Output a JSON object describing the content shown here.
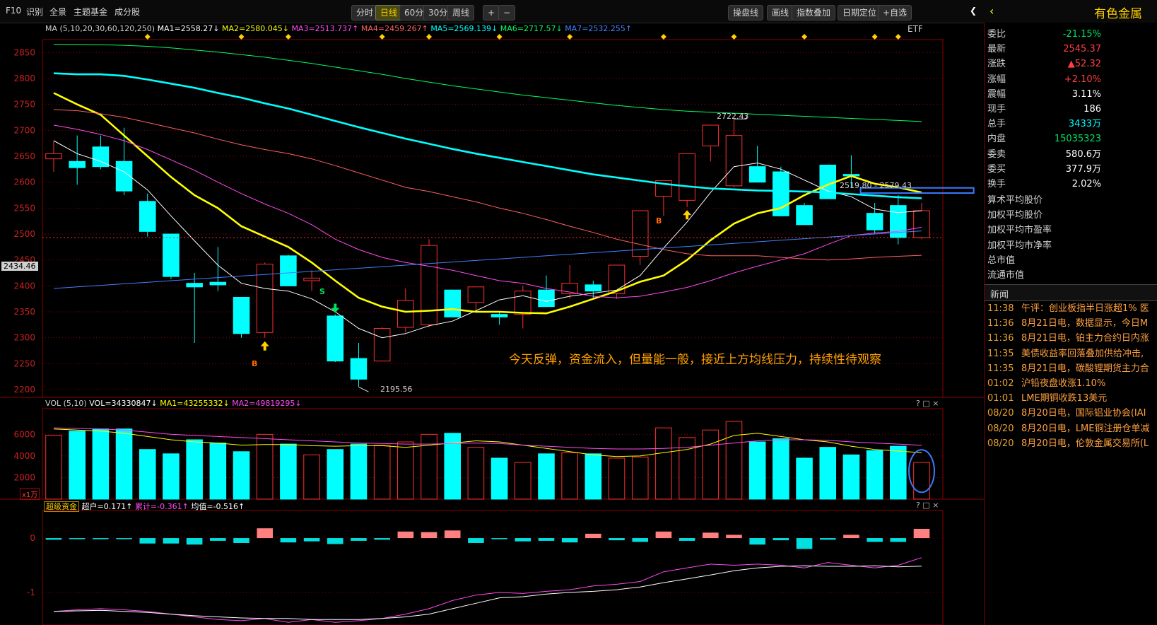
{
  "toolbar": {
    "left_items": [
      "F10",
      "识别",
      "全景",
      "主题基金",
      "成分股"
    ],
    "periods": [
      "分时",
      "日线",
      "60分",
      "30分",
      "周线"
    ],
    "active_period": "日线",
    "zoom_in": "+",
    "zoom_out": "−",
    "right_items": [
      "操盘线",
      "画线",
      "指数叠加",
      "日期定位",
      "+自选"
    ],
    "panel_title": "有色金属"
  },
  "ma_legend": {
    "prefix": "MA",
    "params": "(5,10,20,30,60,120,250)",
    "items": [
      {
        "label": "MA1=2558.27↓",
        "color": "#ffffff"
      },
      {
        "label": "MA2=2580.045↓",
        "color": "#ffff00"
      },
      {
        "label": "MA3=2513.737↑",
        "color": "#ff4af0"
      },
      {
        "label": "MA4=2459.267↑",
        "color": "#ff6060"
      },
      {
        "label": "MA5=2569.139↓",
        "color": "#00ffff"
      },
      {
        "label": "MA6=2717.57↓",
        "color": "#00ff60"
      },
      {
        "label": "MA7=2532.255↑",
        "color": "#4080ff"
      }
    ],
    "etf": "ETF"
  },
  "vol_legend": {
    "prefix": "VOL",
    "params": "(5,10)",
    "items": [
      {
        "label": "VOL=34330847↓",
        "color": "#ffffff"
      },
      {
        "label": "MA1=43255332↓",
        "color": "#ffff00"
      },
      {
        "label": "MA2=49819295↓",
        "color": "#ff4af0"
      }
    ],
    "unit": "x1万"
  },
  "fund_legend": {
    "name": "超级资金",
    "items": [
      {
        "label": "超户=0.171↑",
        "color": "#ffffff"
      },
      {
        "label": "累计=-0.361↑",
        "color": "#ff4af0"
      },
      {
        "label": "均值=-0.516↑",
        "color": "#ffffff"
      }
    ]
  },
  "panel_controls": "? □ ×",
  "annotations": {
    "comment": "今天反弹，资金流入，但量能一般，接近上方均线压力，持续性待观察",
    "high_label": "2722.43",
    "low_label": "2195.56",
    "range_label": "2519.80 - 2579.43",
    "cursor_price": "2434.46",
    "signal_b": "B",
    "signal_s": "S"
  },
  "quote": {
    "rows": [
      {
        "label": "委比",
        "value": "-21.15%",
        "color": "#00e060"
      },
      {
        "label": "最新",
        "value": "2545.37",
        "color": "#ff4040"
      },
      {
        "label": "涨跌",
        "value": "▲52.32",
        "color": "#ff4040"
      },
      {
        "label": "涨幅",
        "value": "+2.10%",
        "color": "#ff4040"
      },
      {
        "label": "震幅",
        "value": "3.11%",
        "color": "#ffffff"
      },
      {
        "label": "现手",
        "value": "186",
        "color": "#ffffff"
      },
      {
        "label": "总手",
        "value": "3433万",
        "color": "#00ffff"
      },
      {
        "label": "内盘",
        "value": "15035323",
        "color": "#00e060"
      },
      {
        "label": "委卖",
        "value": "580.6万",
        "color": "#ffffff"
      },
      {
        "label": "委买",
        "value": "377.9万",
        "color": "#ffffff"
      },
      {
        "label": "换手",
        "value": "2.02%",
        "color": "#ffffff"
      }
    ],
    "extra": [
      "算术平均股价",
      "加权平均股价",
      "加权平均市盈率",
      "加权平均市净率",
      "总市值",
      "流通市值"
    ]
  },
  "news": {
    "title": "新闻",
    "items": [
      {
        "time": "11:38",
        "text": "午评：创业板指半日涨超1% 医"
      },
      {
        "time": "11:36",
        "text": "8月21日电，数据显示，今日M"
      },
      {
        "time": "11:36",
        "text": "8月21日电，铂主力合约日内涨"
      },
      {
        "time": "11:35",
        "text": "美债收益率回落叠加供给冲击,"
      },
      {
        "time": "11:35",
        "text": "8月21日电，碳酸锂期货主力合"
      },
      {
        "time": "01:02",
        "text": "沪铅夜盘收涨1.10%"
      },
      {
        "time": "01:01",
        "text": "LME期铜收跌13美元"
      },
      {
        "time": "08/20",
        "text": "8月20日电，国际铝业协会(IAI"
      },
      {
        "time": "08/20",
        "text": "8月20日电，LME铜注册仓单减"
      },
      {
        "time": "08/20",
        "text": "8月20日电，伦敦金属交易所(L"
      }
    ]
  },
  "chart_data": [
    {
      "type": "candlestick",
      "ylim": [
        2185,
        2875
      ],
      "yticks": [
        2200,
        2250,
        2300,
        2350,
        2400,
        2450,
        2500,
        2550,
        2600,
        2650,
        2700,
        2750,
        2800,
        2850
      ],
      "ohlc": [
        [
          2645,
          2680,
          2620,
          2655
        ],
        [
          2640,
          2690,
          2595,
          2628
        ],
        [
          2668,
          2690,
          2625,
          2630
        ],
        [
          2640,
          2705,
          2575,
          2583
        ],
        [
          2563,
          2578,
          2495,
          2505
        ],
        [
          2500,
          2500,
          2413,
          2418
        ],
        [
          2405,
          2425,
          2290,
          2398
        ],
        [
          2407,
          2475,
          2390,
          2402
        ],
        [
          2378,
          2378,
          2300,
          2308
        ],
        [
          2310,
          2445,
          2300,
          2442
        ],
        [
          2458,
          2460,
          2400,
          2400
        ],
        [
          2410,
          2430,
          2390,
          2415
        ],
        [
          2342,
          2345,
          2253,
          2255
        ],
        [
          2260,
          2290,
          2205,
          2220
        ],
        [
          2255,
          2320,
          2255,
          2318
        ],
        [
          2320,
          2395,
          2310,
          2372
        ],
        [
          2325,
          2490,
          2320,
          2478
        ],
        [
          2392,
          2393,
          2340,
          2340
        ],
        [
          2368,
          2398,
          2350,
          2398
        ],
        [
          2345,
          2350,
          2325,
          2340
        ],
        [
          2345,
          2400,
          2318,
          2390
        ],
        [
          2392,
          2420,
          2360,
          2360
        ],
        [
          2385,
          2440,
          2375,
          2405
        ],
        [
          2402,
          2410,
          2375,
          2390
        ],
        [
          2385,
          2440,
          2375,
          2440
        ],
        [
          2457,
          2545,
          2440,
          2545
        ],
        [
          2573,
          2603,
          2535,
          2603
        ],
        [
          2565,
          2650,
          2552,
          2655
        ],
        [
          2670,
          2710,
          2640,
          2710
        ],
        [
          2593,
          2722,
          2590,
          2690
        ],
        [
          2630,
          2670,
          2600,
          2600
        ],
        [
          2620,
          2630,
          2535,
          2535
        ],
        [
          2555,
          2560,
          2518,
          2518
        ],
        [
          2633,
          2633,
          2568,
          2568
        ],
        [
          2615,
          2652,
          2590,
          2612
        ],
        [
          2540,
          2560,
          2500,
          2508
        ],
        [
          2555,
          2575,
          2480,
          2493
        ],
        [
          2493,
          2560,
          2490,
          2545
        ]
      ],
      "ma": [
        {
          "name": "MA1",
          "color": "#ffffff",
          "values": [
            2680,
            2655,
            2640,
            2620,
            2585,
            2535,
            2487,
            2440,
            2405,
            2395,
            2390,
            2375,
            2350,
            2318,
            2300,
            2308,
            2323,
            2332,
            2352,
            2373,
            2381,
            2370,
            2380,
            2386,
            2392,
            2420,
            2473,
            2523,
            2580,
            2630,
            2637,
            2625,
            2604,
            2583,
            2572,
            2548,
            2541,
            2545
          ]
        },
        {
          "name": "MA2",
          "color": "#ffff00",
          "values": [
            2772,
            2750,
            2730,
            2690,
            2650,
            2610,
            2575,
            2550,
            2515,
            2495,
            2475,
            2445,
            2410,
            2377,
            2360,
            2350,
            2352,
            2355,
            2350,
            2350,
            2348,
            2347,
            2360,
            2375,
            2390,
            2408,
            2420,
            2450,
            2488,
            2520,
            2540,
            2550,
            2575,
            2595,
            2612,
            2597,
            2590,
            2580
          ]
        },
        {
          "name": "MA3",
          "color": "#ff4af0",
          "values": [
            2710,
            2702,
            2692,
            2680,
            2663,
            2643,
            2623,
            2600,
            2578,
            2558,
            2540,
            2518,
            2490,
            2470,
            2455,
            2445,
            2438,
            2430,
            2420,
            2410,
            2405,
            2395,
            2388,
            2380,
            2377,
            2380,
            2388,
            2397,
            2410,
            2425,
            2438,
            2450,
            2462,
            2480,
            2497,
            2502,
            2505,
            2513
          ]
        },
        {
          "name": "MA4",
          "color": "#ff6060",
          "values": [
            2740,
            2738,
            2732,
            2725,
            2715,
            2705,
            2695,
            2683,
            2672,
            2663,
            2655,
            2645,
            2632,
            2618,
            2604,
            2590,
            2582,
            2572,
            2562,
            2550,
            2540,
            2528,
            2515,
            2503,
            2490,
            2480,
            2470,
            2462,
            2458,
            2458,
            2458,
            2455,
            2452,
            2450,
            2452,
            2455,
            2457,
            2459
          ]
        },
        {
          "name": "MA5",
          "color": "#00ffff",
          "values": [
            2810,
            2808,
            2808,
            2805,
            2798,
            2790,
            2782,
            2772,
            2763,
            2752,
            2742,
            2730,
            2718,
            2706,
            2695,
            2684,
            2674,
            2664,
            2655,
            2647,
            2639,
            2631,
            2623,
            2615,
            2609,
            2603,
            2597,
            2592,
            2588,
            2586,
            2584,
            2583,
            2582,
            2580,
            2577,
            2574,
            2571,
            2569
          ]
        },
        {
          "name": "MA6",
          "color": "#00ff60",
          "values": [
            2866,
            2866,
            2865,
            2864,
            2862,
            2859,
            2855,
            2851,
            2846,
            2841,
            2835,
            2829,
            2822,
            2815,
            2808,
            2800,
            2793,
            2786,
            2780,
            2774,
            2768,
            2763,
            2758,
            2753,
            2748,
            2744,
            2740,
            2737,
            2735,
            2733,
            2731,
            2729,
            2727,
            2725,
            2723,
            2721,
            2719,
            2717
          ]
        },
        {
          "name": "MA7",
          "color": "#4080ff",
          "values": [
            2395,
            2398,
            2401,
            2404,
            2407,
            2410,
            2413,
            2416,
            2419,
            2422,
            2425,
            2428,
            2431,
            2434,
            2437,
            2440,
            2443,
            2446,
            2449,
            2452,
            2455,
            2458,
            2461,
            2464,
            2467,
            2470,
            2473,
            2476,
            2479,
            2482,
            2485,
            2488,
            2491,
            2494,
            2497,
            2500,
            2503,
            2506
          ]
        }
      ]
    },
    {
      "type": "bar",
      "ylim": [
        0,
        7200
      ],
      "yticks": [
        2000,
        4000,
        6000
      ],
      "values": [
        5900,
        6300,
        6500,
        6500,
        4600,
        4200,
        5500,
        5200,
        4400,
        6000,
        5100,
        4100,
        4600,
        5100,
        5000,
        5300,
        6000,
        6100,
        4800,
        3800,
        3400,
        4200,
        4300,
        4200,
        3800,
        3900,
        6600,
        5700,
        6400,
        7200,
        5300,
        5600,
        3800,
        4800,
        4100,
        4500,
        4900,
        3400
      ],
      "ma": [
        {
          "name": "MA1",
          "color": "#ffff00",
          "values": [
            6500,
            6400,
            6300,
            6100,
            5800,
            5500,
            5300,
            5200,
            5000,
            5050,
            5050,
            4950,
            4900,
            4950,
            4950,
            4800,
            5000,
            5200,
            5400,
            5300,
            5000,
            4700,
            4400,
            4100,
            3950,
            4000,
            4300,
            4600,
            5100,
            5900,
            6100,
            5800,
            5500,
            5300,
            4900,
            4600,
            4450,
            4300
          ]
        },
        {
          "name": "MA2",
          "color": "#ff4af0",
          "values": [
            6600,
            6550,
            6500,
            6400,
            6200,
            6000,
            5900,
            5800,
            5700,
            5600,
            5500,
            5400,
            5300,
            5200,
            5150,
            5100,
            5100,
            5150,
            5200,
            5150,
            5000,
            4900,
            4800,
            4700,
            4650,
            4650,
            4700,
            4800,
            5000,
            5200,
            5400,
            5500,
            5500,
            5450,
            5300,
            5200,
            5100,
            4980
          ]
        }
      ]
    },
    {
      "type": "bar",
      "ylim": [
        -1.6,
        0.3
      ],
      "yticks": [
        0,
        -1
      ],
      "values": [
        -0.03,
        -0.02,
        -0.02,
        -0.02,
        -0.1,
        -0.1,
        -0.12,
        -0.05,
        -0.09,
        0.18,
        -0.08,
        -0.06,
        -0.11,
        -0.05,
        -0.03,
        0.12,
        0.11,
        0.14,
        -0.09,
        -0.02,
        -0.06,
        -0.05,
        -0.08,
        0.08,
        -0.04,
        -0.07,
        0.12,
        -0.05,
        0.1,
        0.06,
        -0.12,
        -0.04,
        -0.2,
        -0.03,
        0.06,
        -0.07,
        -0.07,
        0.17
      ],
      "lines": [
        {
          "name": "累计",
          "color": "#ff4af0",
          "values": [
            -1.35,
            -1.32,
            -1.3,
            -1.32,
            -1.35,
            -1.4,
            -1.45,
            -1.5,
            -1.52,
            -1.48,
            -1.55,
            -1.5,
            -1.55,
            -1.52,
            -1.48,
            -1.4,
            -1.3,
            -1.15,
            -1.05,
            -1.0,
            -1.02,
            -0.98,
            -0.95,
            -0.88,
            -0.85,
            -0.8,
            -0.62,
            -0.55,
            -0.48,
            -0.5,
            -0.48,
            -0.5,
            -0.55,
            -0.45,
            -0.5,
            -0.55,
            -0.5,
            -0.36
          ]
        },
        {
          "name": "均值",
          "color": "#ffffff",
          "values": [
            -1.35,
            -1.34,
            -1.33,
            -1.35,
            -1.37,
            -1.4,
            -1.43,
            -1.45,
            -1.47,
            -1.48,
            -1.48,
            -1.5,
            -1.5,
            -1.5,
            -1.48,
            -1.45,
            -1.4,
            -1.3,
            -1.2,
            -1.1,
            -1.08,
            -1.03,
            -1.0,
            -0.98,
            -0.95,
            -0.9,
            -0.82,
            -0.75,
            -0.68,
            -0.6,
            -0.55,
            -0.52,
            -0.51,
            -0.52,
            -0.52,
            -0.51,
            -0.53,
            -0.516
          ]
        }
      ]
    }
  ],
  "colors": {
    "up": "#ff3030",
    "down": "#00ffff",
    "grid": "#8a0000",
    "axis_text": "#c82020"
  }
}
